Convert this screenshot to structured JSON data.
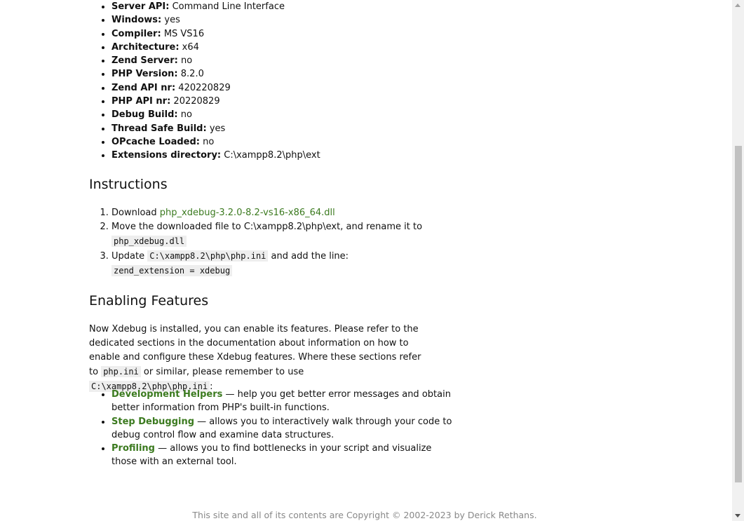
{
  "info_list": [
    {
      "key": "Server API:",
      "value": "Command Line Interface"
    },
    {
      "key": "Windows:",
      "value": "yes"
    },
    {
      "key": "Compiler:",
      "value": "MS VS16"
    },
    {
      "key": "Architecture:",
      "value": "x64"
    },
    {
      "key": "Zend Server:",
      "value": "no"
    },
    {
      "key": "PHP Version:",
      "value": "8.2.0"
    },
    {
      "key": "Zend API nr:",
      "value": "420220829"
    },
    {
      "key": "PHP API nr:",
      "value": "20220829"
    },
    {
      "key": "Debug Build:",
      "value": "no"
    },
    {
      "key": "Thread Safe Build:",
      "value": "yes"
    },
    {
      "key": "OPcache Loaded:",
      "value": "no"
    },
    {
      "key": "Extensions directory:",
      "value": "C:\\xampp8.2\\php\\ext"
    }
  ],
  "instructions": {
    "title": "Instructions",
    "step1_prefix": "Download",
    "step1_link": "php_xdebug-3.2.0-8.2-vs16-x86_64.dll",
    "step2_text": "Move the downloaded file to C:\\xampp8.2\\php\\ext, and rename it to",
    "step2_code": "php_xdebug.dll",
    "step3_prefix": "Update",
    "step3_code": "C:\\xampp8.2\\php\\php.ini",
    "step3_suffix": "and add the line:",
    "step3_line": "zend_extension = xdebug"
  },
  "enabling": {
    "title": "Enabling Features",
    "intro_part1": "Now Xdebug is installed, you can enable its features. Please refer to the dedicated sections in the documentation about information on how to enable and configure these Xdebug features. Where these sections refer to",
    "intro_code1": "php.ini",
    "intro_part2": "or similar, please remember to use",
    "intro_code2": "C:\\xampp8.2\\php\\php.ini",
    "intro_part3": ":",
    "features": [
      {
        "link": "Development Helpers",
        "desc": " — help you get better error messages and obtain better information from PHP's built-in functions."
      },
      {
        "link": "Step Debugging",
        "desc": " — allows you to interactively walk through your code to debug control flow and examine data structures."
      },
      {
        "link": "Profiling",
        "desc": " — allows you to find bottlenecks in your script and visualize those with an external tool."
      }
    ]
  },
  "footer": {
    "text": "This site and all of its contents are Copyright © 2002-2023 by Derick Rethans."
  }
}
